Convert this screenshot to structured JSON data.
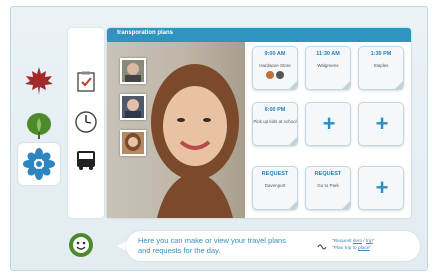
{
  "panel": {
    "title": "transporation plans"
  },
  "tiles": {
    "t1": {
      "time": "9:00 AM",
      "desc": "Hardware Store"
    },
    "t2": {
      "time": "11:30 AM",
      "desc": "Walgreens"
    },
    "t3": {
      "time": "1:30 PM",
      "desc": "Staples"
    },
    "t4": {
      "time": "6:00 PM",
      "desc": "Pick up kids at school"
    },
    "t5": {
      "label": "REQUEST",
      "desc": "Davenport"
    },
    "t6": {
      "label": "REQUEST",
      "desc": "Go to Park"
    },
    "add_symbol": "+"
  },
  "assistant": {
    "message": "Here you can make or view your travel plans and requests for the day.",
    "hint_line1_prefix": "\"Request ",
    "hint_line1_link": "item",
    "hint_line1_mid": " / ",
    "hint_line1_link2": "trip",
    "hint_line1_suffix": "\"",
    "hint_line2_prefix": "\"Plan trip to ",
    "hint_line2_link": "place",
    "hint_line2_suffix": "\""
  },
  "icons": {
    "leaf1": "maple-leaf-icon",
    "leaf2": "green-leaf-icon",
    "leaf3": "blue-flower-icon",
    "tool1": "checklist-icon",
    "tool2": "clock-icon",
    "tool3": "bus-icon",
    "assistant": "smiley-icon",
    "hint": "speech-wave-icon"
  },
  "colors": {
    "header": "#2f94c0",
    "accent": "#2a90c0",
    "maple": "#a32a2a",
    "leaf": "#4c8a2c",
    "flower": "#2e86c1"
  }
}
